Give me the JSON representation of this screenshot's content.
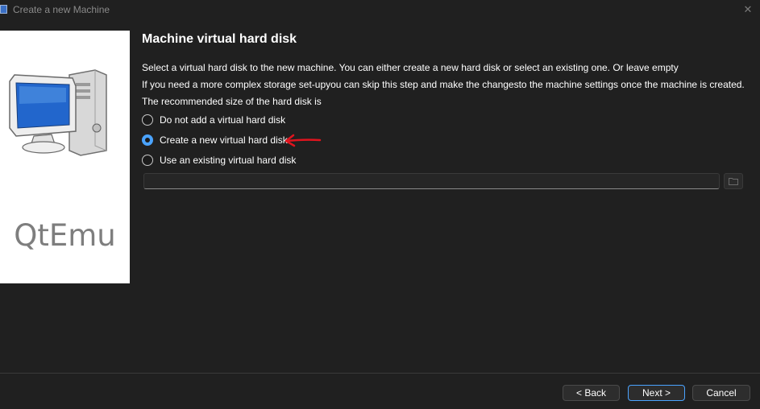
{
  "window": {
    "title": "Create a new Machine",
    "close_glyph": "✕"
  },
  "banner": {
    "logo_text": "QtEmu",
    "icon": "computer-icon"
  },
  "page": {
    "title": "Machine virtual hard disk",
    "description": [
      "Select a virtual hard disk to the new machine. You can either create a new hard disk or select an existing one. Or leave empty",
      "If you need a more complex storage set-upyou can skip this step and make the changesto the machine settings once the machine is created.",
      "The recommended size of the hard disk is"
    ]
  },
  "options": [
    {
      "label": "Do not add a virtual hard disk",
      "checked": false
    },
    {
      "label": "Create a new virtual hard disk",
      "checked": true
    },
    {
      "label": "Use an existing virtual hard disk",
      "checked": false
    }
  ],
  "existing_disk": {
    "path_value": "",
    "browse_icon": "folder-icon"
  },
  "buttons": {
    "back": "< Back",
    "next": "Next >",
    "cancel": "Cancel"
  },
  "colors": {
    "background": "#202020",
    "accent": "#4aa3ff",
    "annotation": "#e0141e"
  }
}
